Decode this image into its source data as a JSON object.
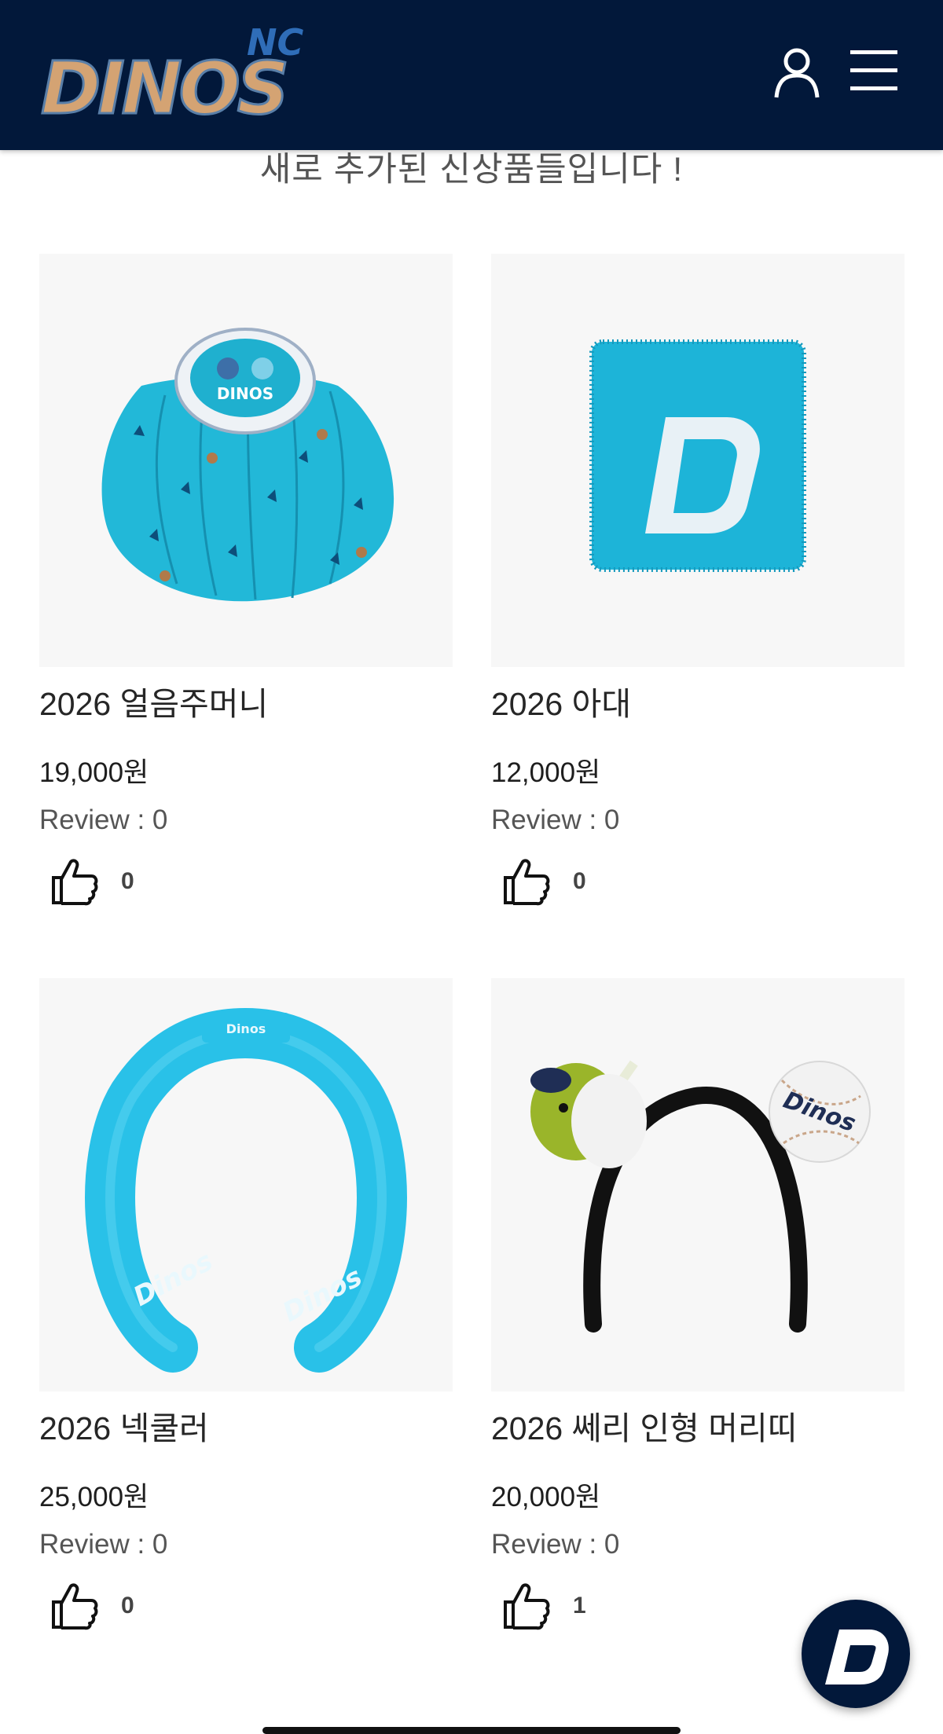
{
  "header": {
    "logo_text": "DINOS",
    "logo_small_text": "NC",
    "icons": {
      "user": "user-icon",
      "menu": "hamburger-menu-icon"
    },
    "background_color": "#02183a"
  },
  "subtitle": "새로 추가된 신상품들입니다 !",
  "products": [
    {
      "name": "2026 얼음주머니",
      "price": "19,000원",
      "review": "Review : 0",
      "likes": "0",
      "image": "ice-bag-image"
    },
    {
      "name": "2026 아대",
      "price": "12,000원",
      "review": "Review : 0",
      "likes": "0",
      "image": "wristband-image"
    },
    {
      "name": "2026 넥쿨러",
      "price": "25,000원",
      "review": "Review : 0",
      "likes": "0",
      "image": "neck-cooler-image"
    },
    {
      "name": "2026 쎄리 인형 머리띠",
      "price": "20,000원",
      "review": "Review : 0",
      "likes": "1",
      "image": "mascot-headband-image"
    }
  ],
  "colors": {
    "accent": "#1ab2dc",
    "brand_navy": "#02183a",
    "logo_gold": "#d4a373"
  },
  "fab_icon": "dinos-d-icon"
}
